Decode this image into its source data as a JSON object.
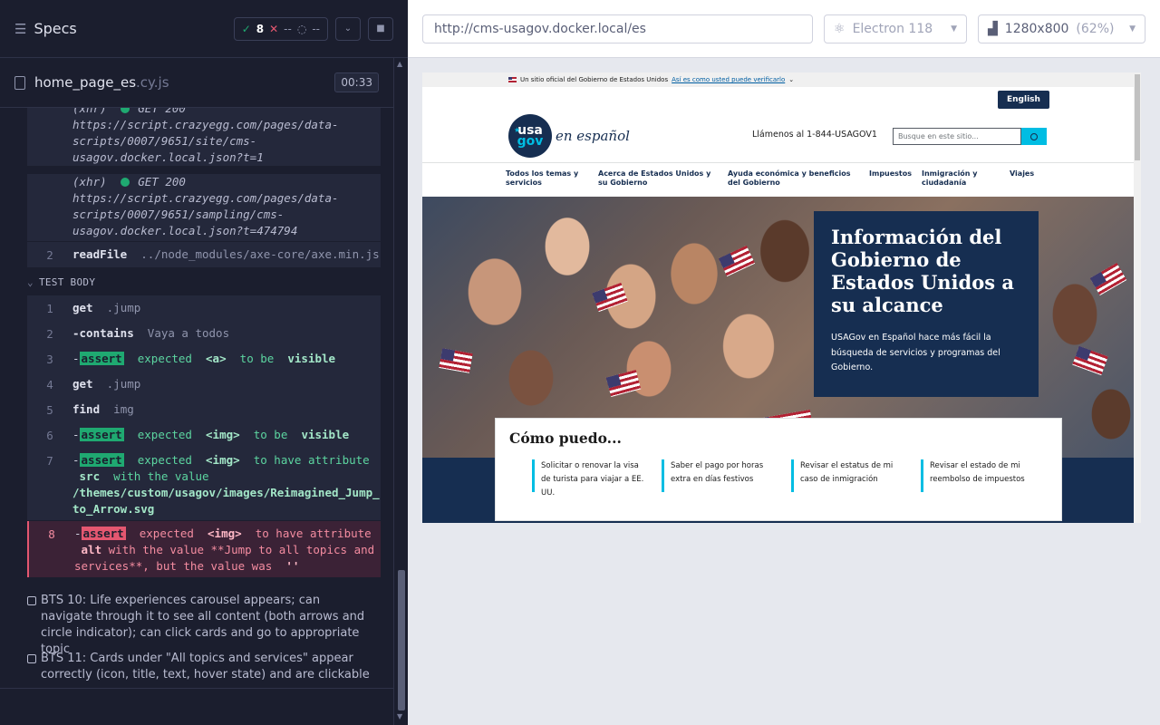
{
  "sidebar": {
    "title": "Specs",
    "stats": {
      "passed": "8",
      "failed": "--",
      "pending": "--"
    }
  },
  "file": {
    "name": "home_page_es",
    "ext": ".cy.js",
    "duration": "00:33"
  },
  "log": {
    "xhr1": {
      "label": "(xhr)",
      "method": "GET 200",
      "url_lines": [
        "https://script.crazyegg.com/pages/data-",
        "scripts/0007/9651/site/cms-",
        "usagov.docker.local.json?t=1"
      ]
    },
    "xhr2": {
      "label": "(xhr)",
      "method": "GET 200",
      "url_lines": [
        "https://script.crazyegg.com/pages/data-",
        "scripts/0007/9651/sampling/cms-",
        "usagov.docker.local.json?t=474794"
      ]
    },
    "readfile": {
      "num": "2",
      "cmd": "readFile",
      "arg": "../node_modules/axe-core/axe.min.js"
    },
    "section": "TEST BODY",
    "commands": [
      {
        "num": "1",
        "cmd": "get",
        "arg": ".jump"
      },
      {
        "num": "2",
        "cmd": "-contains",
        "arg": "Vaya a todos"
      },
      {
        "num": "3",
        "tag": "assert",
        "text": "expected",
        "el": "<a>",
        "rest": "to be",
        "end": "visible"
      },
      {
        "num": "4",
        "cmd": "get",
        "arg": ".jump"
      },
      {
        "num": "5",
        "cmd": "find",
        "arg": "img"
      },
      {
        "num": "6",
        "tag": "assert",
        "text": "expected",
        "el": "<img>",
        "rest": "to be",
        "end": "visible"
      },
      {
        "num": "7",
        "tag": "assert",
        "text": "expected",
        "el": "<img>",
        "rest": "to have attribute",
        "line2a": "src",
        "line2b": "with the value",
        "line3": "/themes/custom/usagov/images/Reimagined_Jump_",
        "line4": "to_Arrow.svg"
      },
      {
        "num": "8",
        "tag": "assert",
        "text": "expected",
        "el": "<img>",
        "rest": "to have attribute",
        "line2a": "alt",
        "line2b": "with the value **Jump to all topics and",
        "line3a": "services**, but the value was",
        "line3b": "''"
      }
    ],
    "pending": [
      "BTS 10: Life experiences carousel appears; can navigate through it to see all content (both arrows and circle indicator); can click cards and go to appropriate topic",
      "BTS 11: Cards under \"All topics and services\" appear correctly (icon, title, text, hover state) and are clickable"
    ]
  },
  "browser": {
    "url": "http://cms-usagov.docker.local/es",
    "name": "Electron 118",
    "viewport": "1280x800",
    "viewport_pct": "(62%)"
  },
  "site": {
    "banner": "Un sitio oficial del Gobierno de Estados Unidos",
    "banner_link": "Así es como usted puede verificarlo",
    "english": "English",
    "logo_top": "usa",
    "logo_bottom": "gov",
    "logo_tag": "en español",
    "phone": "Llámenos al 1-844-USAGOV1",
    "search_placeholder": "Busque en este sitio...",
    "nav": [
      "Todos los temas y servicios",
      "Acerca de Estados Unidos y su Gobierno",
      "Ayuda económica y beneficios del Gobierno",
      "Impuestos",
      "Inmigración y ciudadanía",
      "Viajes"
    ],
    "hero_title": "Información del Gobierno de Estados Unidos a su alcance",
    "hero_text": "USAGov en Español hace más fácil la búsqueda de servicios y programas del Gobierno.",
    "como_title": "Cómo puedo...",
    "cards": [
      "Solicitar o renovar la visa de turista para viajar a EE. UU.",
      "Saber el pago por horas extra en días festivos",
      "Revisar el estatus de mi caso de inmigración",
      "Revisar el estado de mi reembolso de impuestos"
    ]
  },
  "colors": {
    "pass": "#1fa971",
    "fail": "#e45770",
    "navy": "#162e51",
    "cyan": "#00bde3"
  }
}
